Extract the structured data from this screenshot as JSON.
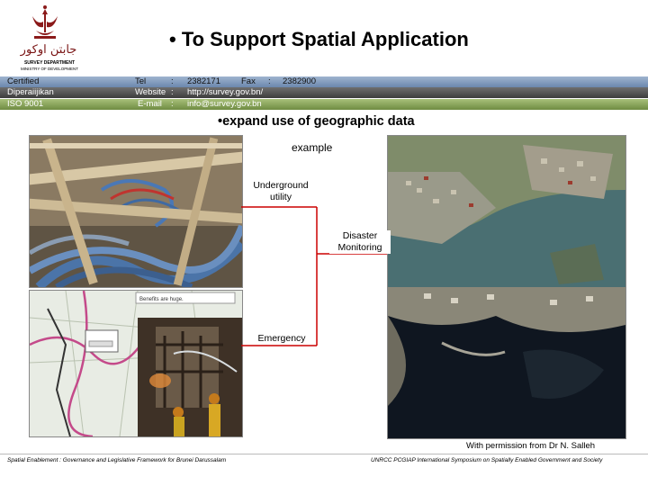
{
  "header": {
    "crest_name": "brunei-crest",
    "jawi_text": "جابتن اوكور",
    "department": "SURVEY DEPARTMENT",
    "ministry": "MINISTRY OF DEVELOPMENT",
    "title": "To Support Spatial Application"
  },
  "info_bar": {
    "row1": {
      "left": "Certified",
      "tel_label": "Tel",
      "colon": ":",
      "tel": "2382171",
      "fax_label": "Fax",
      "fax": "2382900"
    },
    "row2": {
      "left": "Diperaiijikan",
      "web_label": "Website",
      "colon": ":",
      "website": "http://survey.gov.bn/"
    },
    "row3": {
      "left": "ISO 9001",
      "email_label": "E-mail",
      "colon": ":",
      "email": "info@survey.gov.bn"
    }
  },
  "content": {
    "bullet": "expand use of geographic data",
    "example": "example",
    "labels": {
      "underground": "Underground utility",
      "disaster": "Disaster Monitoring",
      "emergency": "Emergency"
    },
    "credit": "With permission from Dr N. Salleh",
    "map_popup_text": "Benefits are huge."
  },
  "footer": {
    "left": "Spatial Enablement : Governance and Legislative Framework for Brunei Darussalam",
    "right": "UNRCC PCGIAP International Symposium on Spatially Enabled Government and Society"
  },
  "colors": {
    "band1": "#7f99bd",
    "band2": "#555555",
    "band3": "#86a257",
    "connector": "#cc0000"
  }
}
